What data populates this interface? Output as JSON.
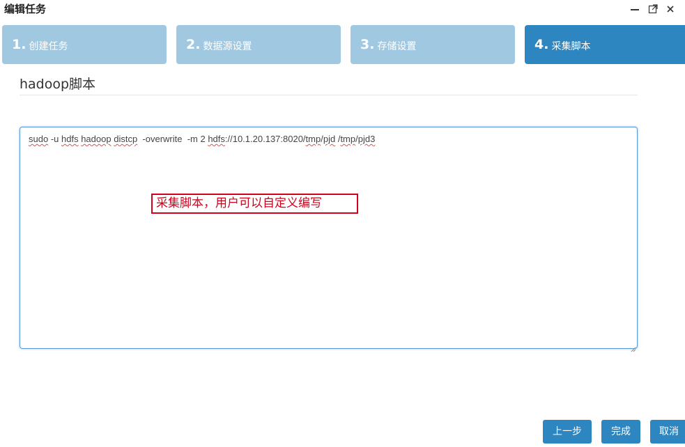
{
  "dialog": {
    "title": "编辑任务"
  },
  "steps": [
    {
      "num": "1.",
      "label": "创建任务",
      "active": false
    },
    {
      "num": "2.",
      "label": "数据源设置",
      "active": false
    },
    {
      "num": "3.",
      "label": "存储设置",
      "active": false
    },
    {
      "num": "4.",
      "label": "采集脚本",
      "active": true
    }
  ],
  "section": {
    "title": "hadoop脚本"
  },
  "script": {
    "value": "sudo -u hdfs hadoop distcp  -overwrite  -m 2 hdfs://10.1.20.137:8020/tmp/pjd /tmp/pjd3"
  },
  "annotation": {
    "text": "采集脚本，用户可以自定义编写"
  },
  "buttons": {
    "prev": "上一步",
    "finish": "完成",
    "cancel": "取消"
  },
  "colors": {
    "step_inactive": "#a0c8e1",
    "step_active": "#2e86c1",
    "button": "#2e86c1",
    "annotation": "#d0021b"
  },
  "icons": {
    "minimize": "minimize-icon",
    "maximize": "maximize-icon",
    "close": "close-icon"
  }
}
